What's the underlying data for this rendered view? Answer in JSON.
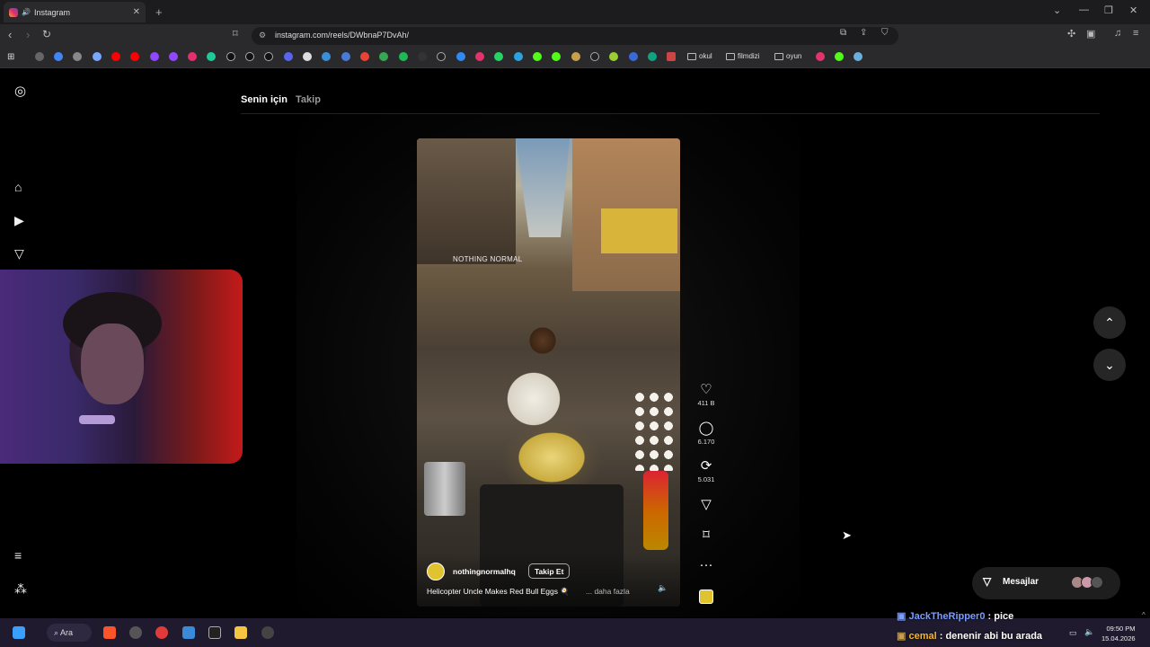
{
  "browser": {
    "tab_title": "Instagram",
    "url": "instagram.com/reels/DWbnaP7DvAh/",
    "bookmarks": [
      "okul",
      "filmdizi",
      "oyun"
    ]
  },
  "instagram": {
    "feed_tabs": [
      {
        "label": "Senin için",
        "active": true
      },
      {
        "label": "Takip",
        "active": false
      }
    ],
    "reel": {
      "watermark": "NOTHING NORMAL",
      "username": "nothingnormalhq",
      "follow_label": "Takip Et",
      "caption": "Helicopter Uncle Makes Red Bull Eggs 🍳",
      "more_label": "... daha fazla",
      "likes": "411 B",
      "comments": "6.170",
      "reposts": "5.031"
    },
    "messages_label": "Mesajlar"
  },
  "stream_chat": [
    {
      "user": "JackTheRipper0",
      "text": ": pice",
      "user_color": "#7a9dff"
    },
    {
      "user": "cemal",
      "text": ": denenir abi bu arada",
      "user_color": "#f5b731"
    }
  ],
  "taskbar": {
    "search_label": "Ara",
    "time": "09:50 PM",
    "date": "15.04.2026"
  },
  "colors": {
    "page_bg": "#000000",
    "chrome_bg": "#2a2a2c",
    "taskbar_bg": "#1f1a2e",
    "audio_badge": "#e1c22f"
  }
}
